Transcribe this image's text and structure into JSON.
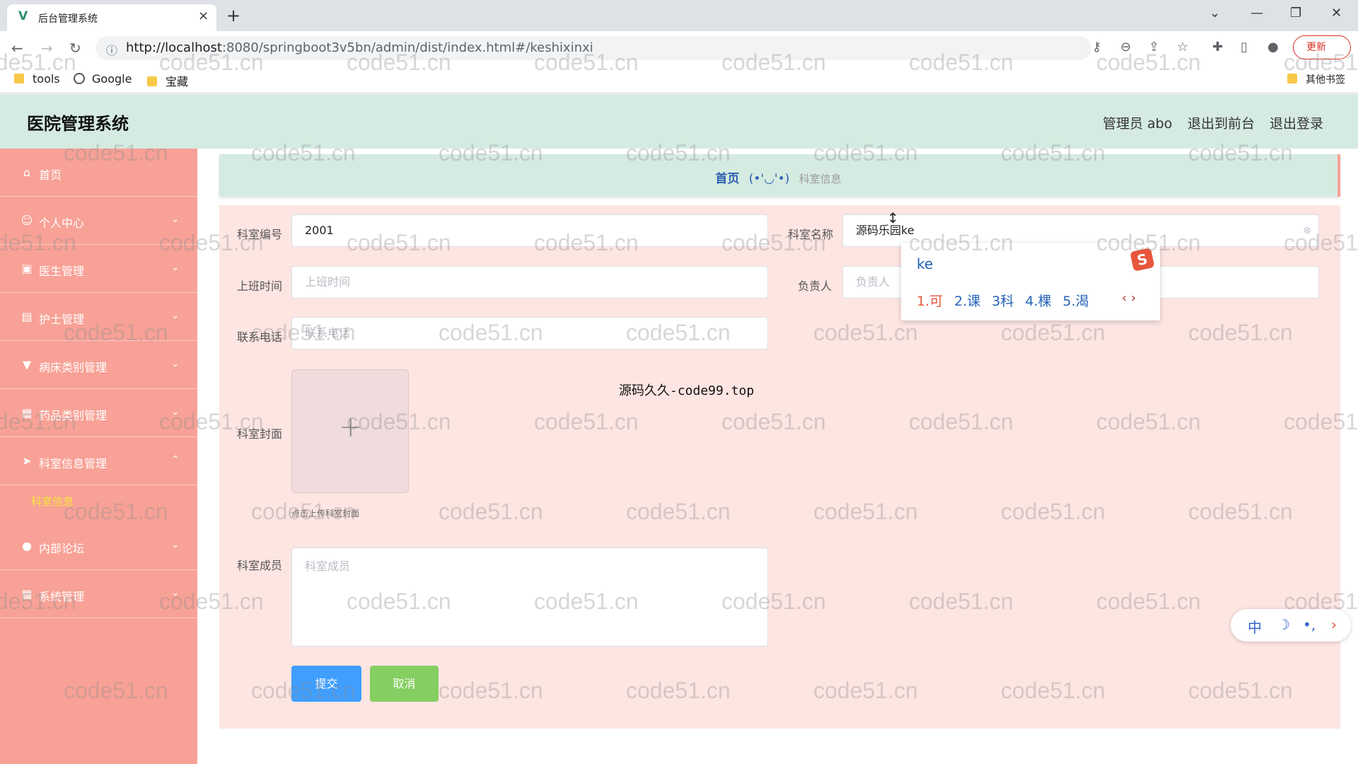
{
  "browser": {
    "tab_title": "后台管理系统",
    "tab_close": "×",
    "new_tab": "+",
    "url_host": "http://localhost",
    "url_path": ":8080/springboot3v5bn/admin/dist/index.html#/keshixinxi",
    "update_label": "更新",
    "bookmarks": [
      "tools",
      "Google",
      "宝藏"
    ],
    "other_bookmarks": "其他书签"
  },
  "header": {
    "title": "医院管理系统",
    "admin": "管理员 abo",
    "back_front": "退出到前台",
    "logout": "退出登录"
  },
  "sidebar": {
    "items": [
      {
        "label": "首页",
        "icon": "⌂",
        "chevron": ""
      },
      {
        "label": "个人中心",
        "icon": "☺",
        "chevron": "⌄"
      },
      {
        "label": "医生管理",
        "icon": "▣",
        "chevron": "⌄"
      },
      {
        "label": "护士管理",
        "icon": "▤",
        "chevron": "⌄"
      },
      {
        "label": "病床类别管理",
        "icon": "▼",
        "chevron": "⌄"
      },
      {
        "label": "药品类别管理",
        "icon": "▦",
        "chevron": "⌄"
      },
      {
        "label": "科室信息管理",
        "icon": "➤",
        "chevron": "⌃"
      },
      {
        "label": "内部论坛",
        "icon": "●",
        "chevron": "⌄"
      },
      {
        "label": "系统管理",
        "icon": "▦",
        "chevron": "⌄"
      }
    ],
    "sub_active": "科室信息"
  },
  "breadcrumb": {
    "home": "首页",
    "face": "(•'◡'•)",
    "current": "科室信息"
  },
  "form": {
    "dept_no_label": "科室编号",
    "dept_no_value": "2001",
    "dept_name_label": "科室名称",
    "dept_name_value": "源码乐园ke",
    "shift_label": "上班时间",
    "shift_placeholder": "上班时间",
    "head_label": "负责人",
    "head_placeholder": "负责人",
    "phone_label": "联系电话",
    "phone_placeholder": "联系电话",
    "cover_label": "科室封面",
    "cover_hint": "点击上传科室封面",
    "members_label": "科室成员",
    "members_placeholder": "科室成员",
    "submit": "提交",
    "cancel": "取消",
    "source_note": "源码久久-code99.top"
  },
  "ime": {
    "typed": "ke",
    "logo": "S",
    "candidates": [
      "1.可",
      "2.课",
      "3科",
      "4.棵",
      "5.渴"
    ],
    "bar": [
      "中",
      "☽",
      "•,",
      "›"
    ]
  },
  "watermark": "code51.cn"
}
